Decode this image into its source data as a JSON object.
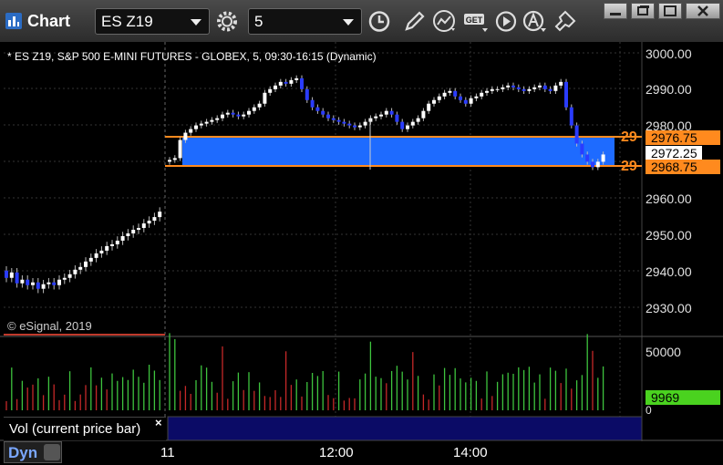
{
  "toolbar": {
    "app_title": "Chart",
    "symbol_value": "ES Z19",
    "interval_value": "5",
    "icons": [
      "gear-icon",
      "clock-icon",
      "pencil-icon",
      "study-icon",
      "get-icon",
      "play-icon",
      "a-icon",
      "pin-icon"
    ]
  },
  "chart": {
    "info": "* ES Z19, S&P 500 E-MINI FUTURES - GLOBEX, 5, 09:30-16:15 (Dynamic)",
    "copyright": "© eSignal, 2019",
    "price_labels": [
      "3000.00",
      "2990.00",
      "2980.00",
      "2960.00",
      "2950.00",
      "2940.00",
      "2930.00"
    ],
    "tag_upper": "2976.75",
    "tag_last": "2972.25",
    "tag_lower": "2968.75",
    "side_marker_upper": "29",
    "side_marker_lower": "29",
    "volume_labels": [
      "50000",
      "0"
    ],
    "volume_tag": "9969",
    "vol_panel_label": "Vol (current price bar)",
    "vol_close": "×",
    "time_labels": [
      "11",
      "12:00",
      "14:00"
    ],
    "dyn_label": "Dyn",
    "colors": {
      "up": "#ffffff",
      "down": "#2a3cff",
      "zone": "#1e6bff",
      "zone_border": "#ff8a1e",
      "vol_up": "#3ec43e",
      "vol_down": "#c62828"
    }
  }
}
